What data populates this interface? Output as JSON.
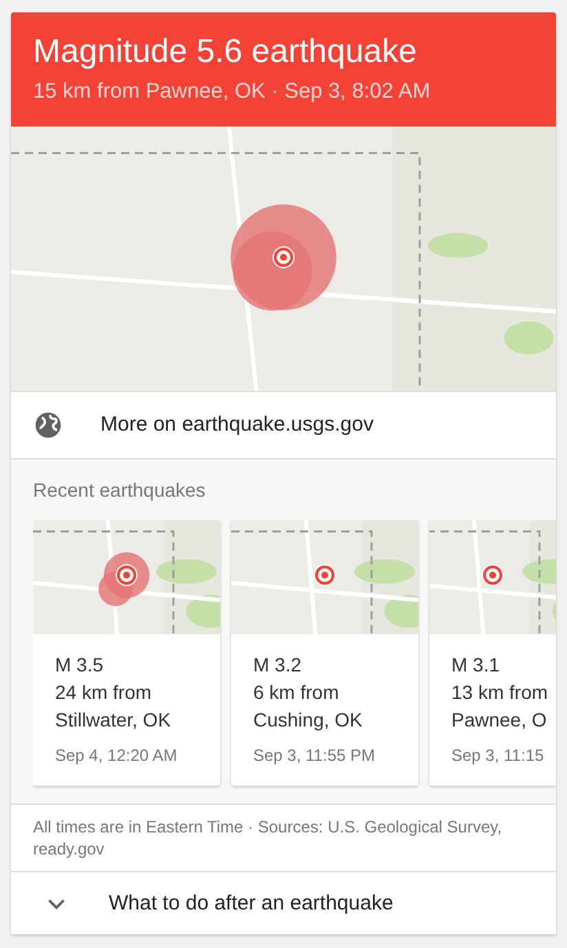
{
  "header": {
    "title": "Magnitude 5.6 earthquake",
    "subtitle": "15 km from Pawnee, OK · Sep 3, 8:02 AM"
  },
  "more_link": {
    "label": "More on earthquake.usgs.gov"
  },
  "recent": {
    "heading": "Recent earthquakes",
    "items": [
      {
        "magnitude": "M 3.5",
        "distance": "24 km from",
        "place": "Stillwater, OK",
        "time": "Sep 4, 12:20 AM",
        "large_area": true
      },
      {
        "magnitude": "M 3.2",
        "distance": "6 km from",
        "place": "Cushing, OK",
        "time": "Sep 3, 11:55 PM",
        "large_area": false
      },
      {
        "magnitude": "M 3.1",
        "distance": "13 km from",
        "place": "Pawnee, O",
        "time": "Sep 3, 11:15",
        "large_area": false
      }
    ]
  },
  "footer_note": "All times are in Eastern Time · Sources: U.S. Geological Survey, ready.gov",
  "expander": {
    "label": "What to do after an earthquake",
    "expanded": false
  }
}
